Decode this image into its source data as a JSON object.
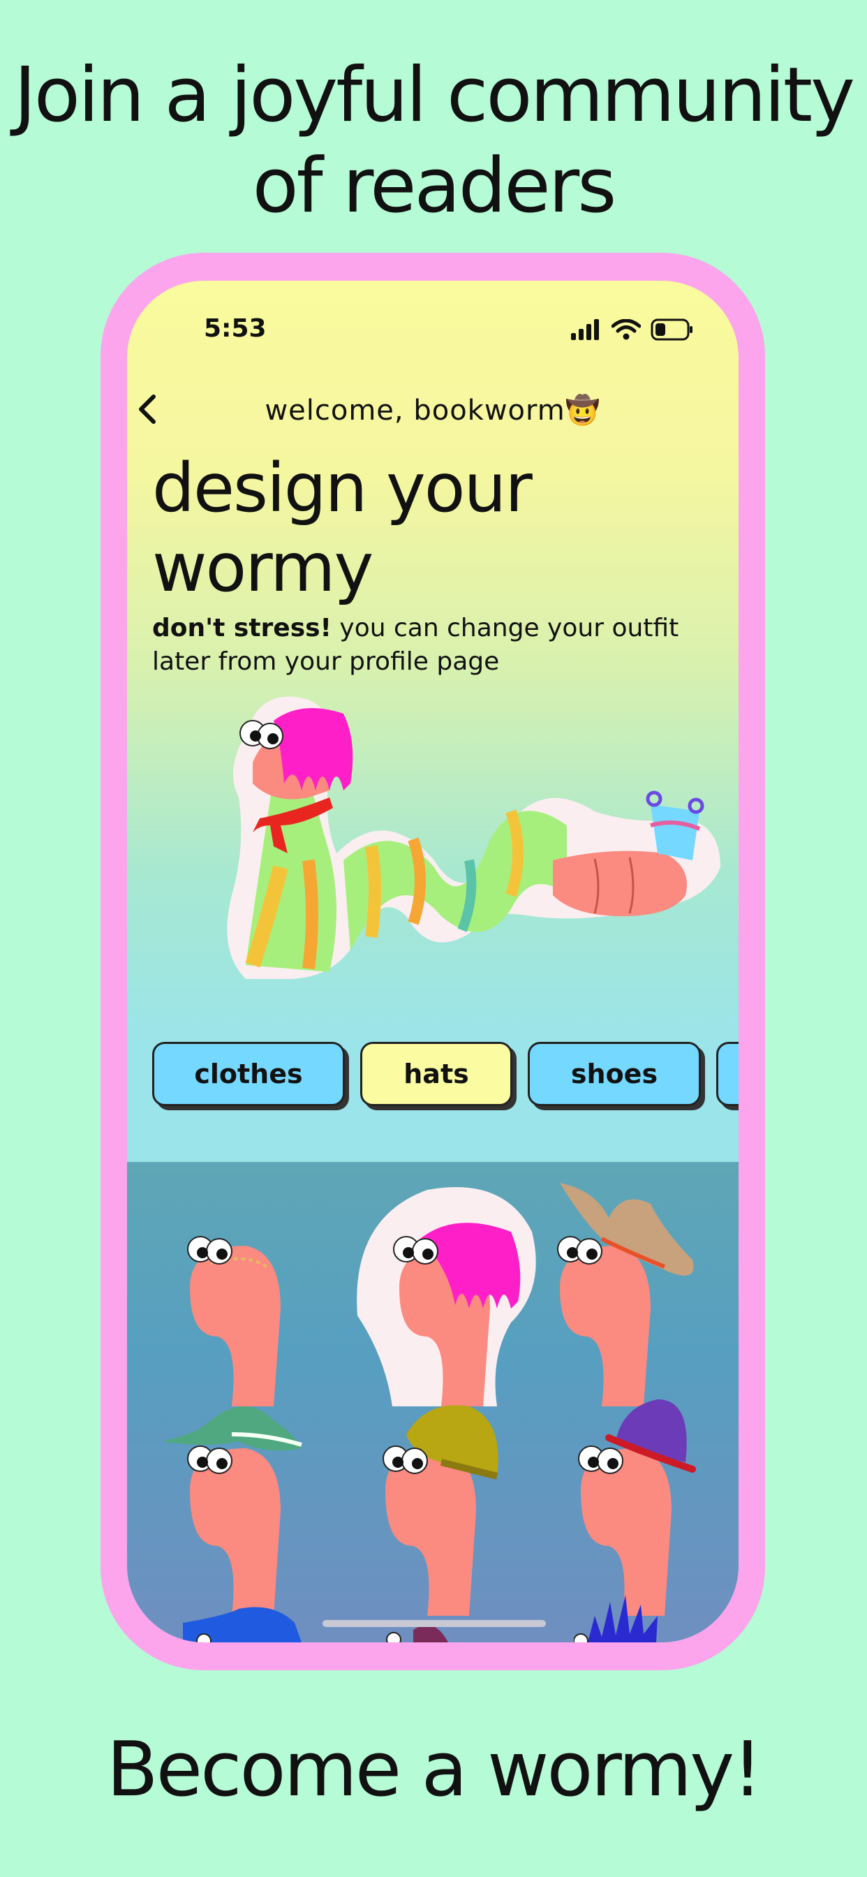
{
  "promo": {
    "headline": "Join a joyful community of readers",
    "footer": "Become a wormy!"
  },
  "status_bar": {
    "time": "5:53"
  },
  "nav": {
    "title": "welcome, bookworm",
    "emoji": "🤠"
  },
  "page": {
    "title_line1": "design your",
    "title_line2": "wormy",
    "subtitle_bold": "don't stress!",
    "subtitle_rest": " you can change your outfit later from your profile page"
  },
  "categories": [
    {
      "label": "clothes",
      "color": "#74d8ff"
    },
    {
      "label": "hats",
      "color": "#fbfba2"
    },
    {
      "label": "shoes",
      "color": "#74d8ff"
    }
  ],
  "hat_options": [
    {
      "icon": "worm-no-hat-icon"
    },
    {
      "icon": "worm-pink-hair-icon",
      "selected": true
    },
    {
      "icon": "worm-cowboy-hat-icon"
    },
    {
      "icon": "worm-green-bucket-hat-icon"
    },
    {
      "icon": "worm-olive-beanie-icon"
    },
    {
      "icon": "worm-purple-hat-icon"
    },
    {
      "icon": "worm-blue-cap-icon"
    },
    {
      "icon": "worm-beret-icon"
    },
    {
      "icon": "worm-spiky-hair-icon"
    }
  ],
  "colors": {
    "background": "#b5fbd5",
    "phone_frame": "#fca4ec",
    "worm_body": "#fb8a80",
    "chip_blue": "#74d8ff",
    "chip_yellow": "#fbfba2"
  }
}
